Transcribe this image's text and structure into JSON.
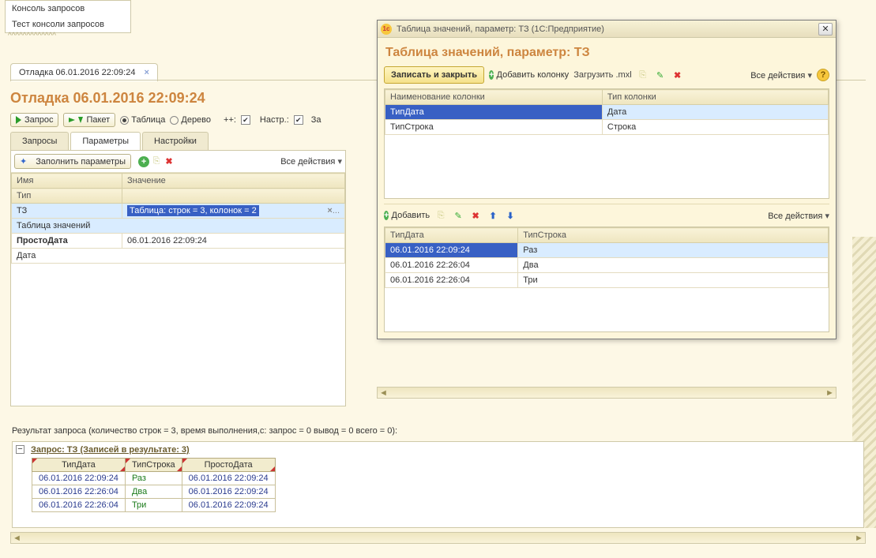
{
  "menu": {
    "items": [
      "Консоль запросов",
      "Тест консоли запросов"
    ]
  },
  "file_tab": {
    "label": "Отладка 06.01.2016 22:09:24"
  },
  "page_title": "Отладка 06.01.2016 22:09:24",
  "main_toolbar": {
    "query_btn": "Запрос",
    "packet_btn": "Пакет",
    "radio_table": "Таблица",
    "radio_tree": "Дерево",
    "plusplus": "++:",
    "settings_label": "Настр.:",
    "za": "За"
  },
  "subtabs": {
    "queries": "Запросы",
    "params": "Параметры",
    "settings": "Настройки"
  },
  "param_toolbar": {
    "fill": "Заполнить параметры",
    "actions": "Все действия"
  },
  "param_grid": {
    "col_name": "Имя",
    "col_value": "Значение",
    "col_type": "Тип",
    "rows": [
      {
        "name": "ТЗ",
        "value": "Таблица: строк = 3, колонок = 2",
        "type": "Таблица значений",
        "selected": true
      },
      {
        "name": "ПростоДата",
        "value": "06.01.2016 22:09:24",
        "type": "Дата"
      }
    ],
    "edit_btn": "..."
  },
  "result_label": "Результат запроса (количество строк = 3, время выполнения,с: запрос = 0  вывод = 0  всего = 0):",
  "result_header": "Запрос: ТЗ (Записей в результате: 3)",
  "result_table": {
    "cols": [
      "ТипДата",
      "ТипСтрока",
      "ПростоДата"
    ],
    "rows": [
      [
        "06.01.2016 22:09:24",
        "Раз",
        "06.01.2016 22:09:24"
      ],
      [
        "06.01.2016 22:26:04",
        "Два",
        "06.01.2016 22:09:24"
      ],
      [
        "06.01.2016 22:26:04",
        "Три",
        "06.01.2016 22:09:24"
      ]
    ]
  },
  "modal": {
    "win_title": "Таблица значений, параметр: ТЗ  (1С:Предприятие)",
    "title": "Таблица значений, параметр: ТЗ",
    "save_close": "Записать и закрыть",
    "add_col": "Добавить колонку",
    "load_mxl": "Загрузить .mxl",
    "all_actions": "Все действия",
    "cols_grid": {
      "h_name": "Наименование колонки",
      "h_type": "Тип колонки",
      "rows": [
        {
          "name": "ТипДата",
          "type": "Дата",
          "sel": true
        },
        {
          "name": "ТипСтрока",
          "type": "Строка"
        }
      ]
    },
    "data_toolbar": {
      "add": "Добавить",
      "all_actions": "Все действия"
    },
    "data_grid": {
      "h1": "ТипДата",
      "h2": "ТипСтрока",
      "rows": [
        {
          "d": "06.01.2016 22:09:24",
          "s": "Раз",
          "sel": true
        },
        {
          "d": "06.01.2016 22:26:04",
          "s": "Два"
        },
        {
          "d": "06.01.2016 22:26:04",
          "s": "Три"
        }
      ]
    }
  }
}
